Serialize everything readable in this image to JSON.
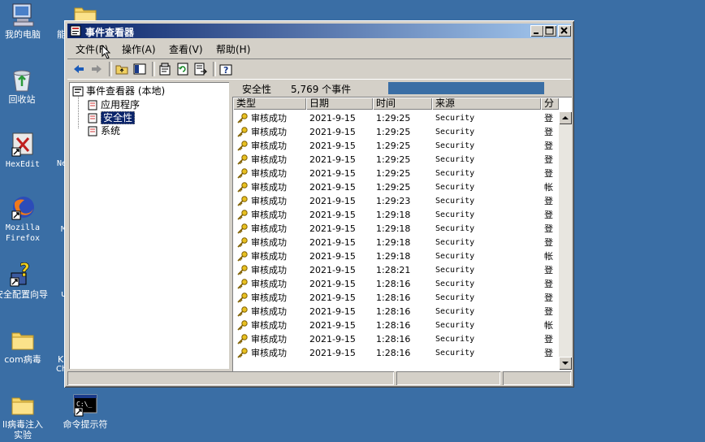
{
  "desktop": {
    "icons": [
      {
        "label": "我的电脑"
      },
      {
        "label": "回收站"
      },
      {
        "label": "HexEdit"
      },
      {
        "label": "Mozilla Firefox",
        "line1": "Mozilla",
        "line2": "Firefox"
      },
      {
        "label": "安全配置向导"
      },
      {
        "label": "com病毒"
      },
      {
        "label": "dll病毒注入实验",
        "line1": "ll病毒注入",
        "line2": "实验"
      },
      {
        "label": "命令提示符"
      }
    ],
    "partial_labels": [
      "能",
      "Ne",
      "M",
      "u",
      "K",
      "Ch"
    ],
    "background_color": "#3a6ea5"
  },
  "window": {
    "title": "事件查看器",
    "title_buttons": [
      "minimize",
      "maximize",
      "close"
    ],
    "menus": [
      "文件(F)",
      "操作(A)",
      "查看(V)",
      "帮助(H)"
    ],
    "toolbar_icons": [
      "back-arrow-icon",
      "forward-arrow-icon",
      "up-folder-icon",
      "show-hide-tree-icon",
      "properties-icon",
      "refresh-icon",
      "export-icon",
      "help-icon"
    ]
  },
  "tree": {
    "root": "事件查看器 (本地)",
    "items": [
      {
        "label": "应用程序",
        "selected": false
      },
      {
        "label": "安全性",
        "selected": true
      },
      {
        "label": "系统",
        "selected": false
      }
    ]
  },
  "pane": {
    "name": "安全性",
    "count_text": "5,769 个事件",
    "columns": [
      "类型",
      "日期",
      "时间",
      "来源",
      "分类"
    ],
    "column_truncated": "分"
  },
  "events": [
    {
      "type": "审核成功",
      "date": "2021-9-15",
      "time": "1:29:25",
      "source": "Security",
      "category": "登"
    },
    {
      "type": "审核成功",
      "date": "2021-9-15",
      "time": "1:29:25",
      "source": "Security",
      "category": "登"
    },
    {
      "type": "审核成功",
      "date": "2021-9-15",
      "time": "1:29:25",
      "source": "Security",
      "category": "登"
    },
    {
      "type": "审核成功",
      "date": "2021-9-15",
      "time": "1:29:25",
      "source": "Security",
      "category": "登"
    },
    {
      "type": "审核成功",
      "date": "2021-9-15",
      "time": "1:29:25",
      "source": "Security",
      "category": "登"
    },
    {
      "type": "审核成功",
      "date": "2021-9-15",
      "time": "1:29:25",
      "source": "Security",
      "category": "帐"
    },
    {
      "type": "审核成功",
      "date": "2021-9-15",
      "time": "1:29:23",
      "source": "Security",
      "category": "登"
    },
    {
      "type": "审核成功",
      "date": "2021-9-15",
      "time": "1:29:18",
      "source": "Security",
      "category": "登"
    },
    {
      "type": "审核成功",
      "date": "2021-9-15",
      "time": "1:29:18",
      "source": "Security",
      "category": "登"
    },
    {
      "type": "审核成功",
      "date": "2021-9-15",
      "time": "1:29:18",
      "source": "Security",
      "category": "登"
    },
    {
      "type": "审核成功",
      "date": "2021-9-15",
      "time": "1:29:18",
      "source": "Security",
      "category": "帐"
    },
    {
      "type": "审核成功",
      "date": "2021-9-15",
      "time": "1:28:21",
      "source": "Security",
      "category": "登"
    },
    {
      "type": "审核成功",
      "date": "2021-9-15",
      "time": "1:28:16",
      "source": "Security",
      "category": "登"
    },
    {
      "type": "审核成功",
      "date": "2021-9-15",
      "time": "1:28:16",
      "source": "Security",
      "category": "登"
    },
    {
      "type": "审核成功",
      "date": "2021-9-15",
      "time": "1:28:16",
      "source": "Security",
      "category": "登"
    },
    {
      "type": "审核成功",
      "date": "2021-9-15",
      "time": "1:28:16",
      "source": "Security",
      "category": "帐"
    },
    {
      "type": "审核成功",
      "date": "2021-9-15",
      "time": "1:28:16",
      "source": "Security",
      "category": "登"
    },
    {
      "type": "审核成功",
      "date": "2021-9-15",
      "time": "1:28:16",
      "source": "Security",
      "category": "登"
    }
  ],
  "colors": {
    "title_gradient_start": "#0a246a",
    "title_gradient_end": "#a6caf0",
    "selection": "#0a246a",
    "window_face": "#d4d0c8"
  }
}
